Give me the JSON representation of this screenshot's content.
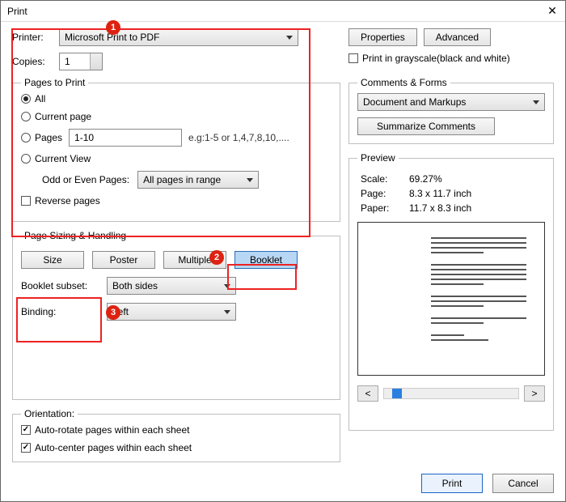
{
  "window": {
    "title": "Print"
  },
  "printer": {
    "label": "Printer:",
    "selected": "Microsoft Print to PDF",
    "properties_btn": "Properties",
    "advanced_btn": "Advanced",
    "copies_label": "Copies:",
    "copies_value": "1",
    "grayscale_label": "Print in grayscale(black and white)"
  },
  "pages": {
    "legend": "Pages to Print",
    "all": "All",
    "current": "Current page",
    "pages_label": "Pages",
    "pages_value": "1-10",
    "pages_example": "e.g:1-5 or 1,4,7,8,10,....",
    "current_view": "Current View",
    "odd_even_label": "Odd or Even Pages:",
    "odd_even_value": "All pages in range",
    "reverse": "Reverse pages"
  },
  "sizing": {
    "legend": "Page Sizing & Handling",
    "size": "Size",
    "poster": "Poster",
    "multiple": "Multiple",
    "booklet": "Booklet",
    "subset_label": "Booklet subset:",
    "subset_value": "Both sides",
    "binding_label": "Binding:",
    "binding_value": "Left"
  },
  "orientation": {
    "legend": "Orientation:",
    "autorotate": "Auto-rotate pages within each sheet",
    "autocenter": "Auto-center pages within each sheet"
  },
  "comments": {
    "legend": "Comments & Forms",
    "value": "Document and Markups",
    "summarize": "Summarize Comments"
  },
  "preview": {
    "legend": "Preview",
    "scale_label": "Scale:",
    "scale_value": "69.27%",
    "page_label": "Page:",
    "page_value": "8.3 x 11.7 inch",
    "paper_label": "Paper:",
    "paper_value": "11.7 x 8.3 inch",
    "prev": "<",
    "next": ">"
  },
  "footer": {
    "print": "Print",
    "cancel": "Cancel"
  },
  "annotations": {
    "a1": "1",
    "a2": "2",
    "a3": "3"
  }
}
